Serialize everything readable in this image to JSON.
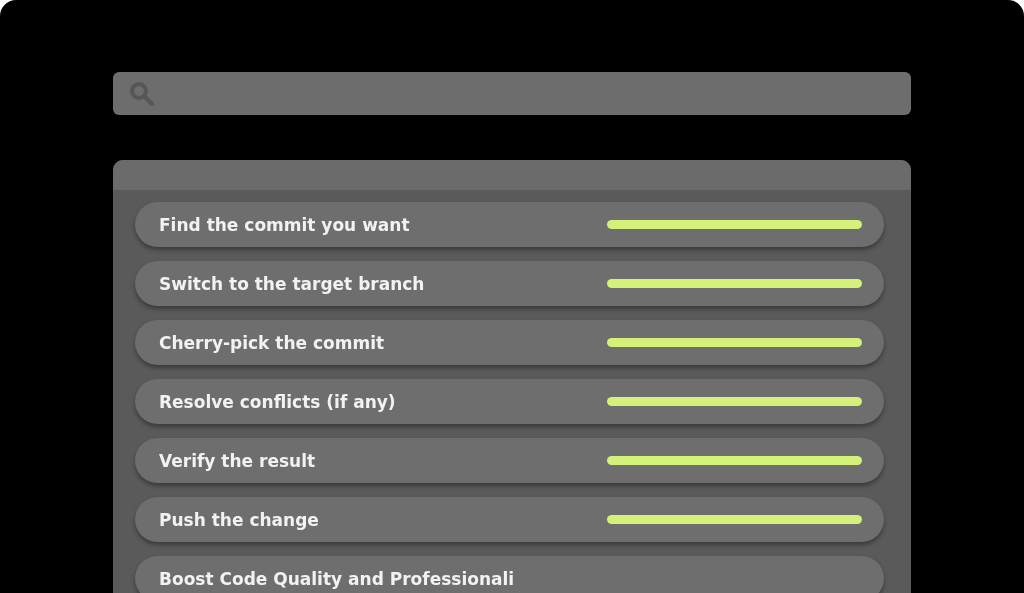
{
  "search": {
    "kind": "search"
  },
  "steps": [
    {
      "label": "Find the commit you want",
      "level": 1
    },
    {
      "label": "Switch to the target branch",
      "level": 1
    },
    {
      "label": "Cherry-pick the commit",
      "level": 1
    },
    {
      "label": "Resolve conflicts (if any)",
      "level": 1
    },
    {
      "label": "Verify the result",
      "level": 1
    },
    {
      "label": "Push the change",
      "level": 1
    },
    {
      "label": "Boost Code Quality and Professionali"
    }
  ]
}
